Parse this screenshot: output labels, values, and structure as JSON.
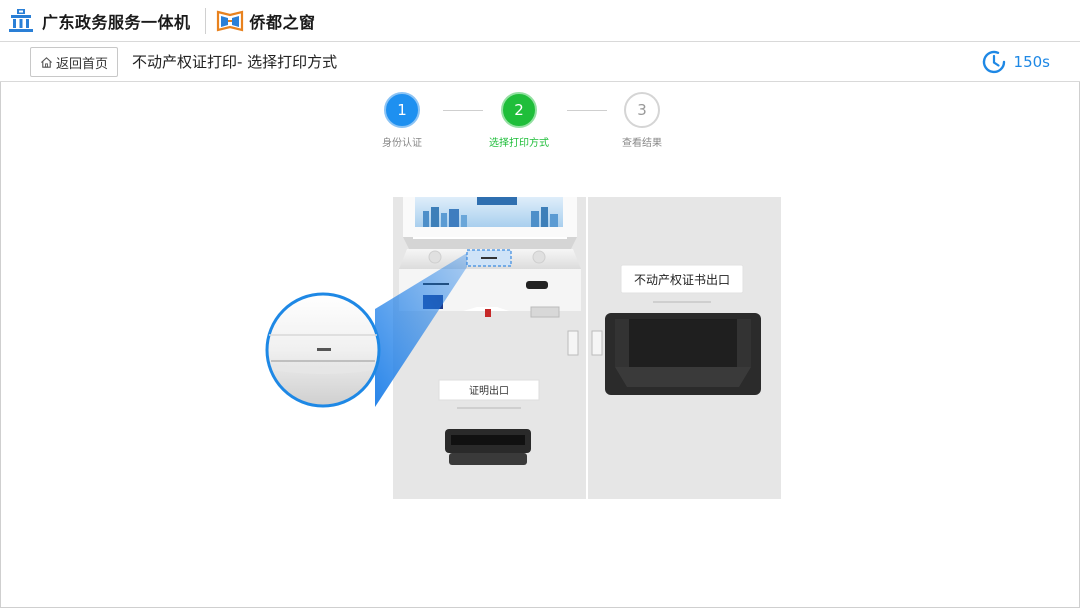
{
  "header": {
    "brand_name": "广东政务服务一体机",
    "partner_name": "侨都之窗"
  },
  "subbar": {
    "home_label": "返回首页",
    "title": "不动产权证打印- 选择打印方式",
    "timer": "150s"
  },
  "steps": [
    {
      "number": "1",
      "label": "身份认证",
      "state": "done"
    },
    {
      "number": "2",
      "label": "选择打印方式",
      "state": "current"
    },
    {
      "number": "3",
      "label": "查看结果",
      "state": "pending"
    }
  ],
  "illustration": {
    "cert_outlet_label": "证明出口",
    "property_outlet_label": "不动产权证书出口"
  },
  "colors": {
    "accent_blue": "#1e90f0",
    "accent_green": "#1fbe3a"
  }
}
